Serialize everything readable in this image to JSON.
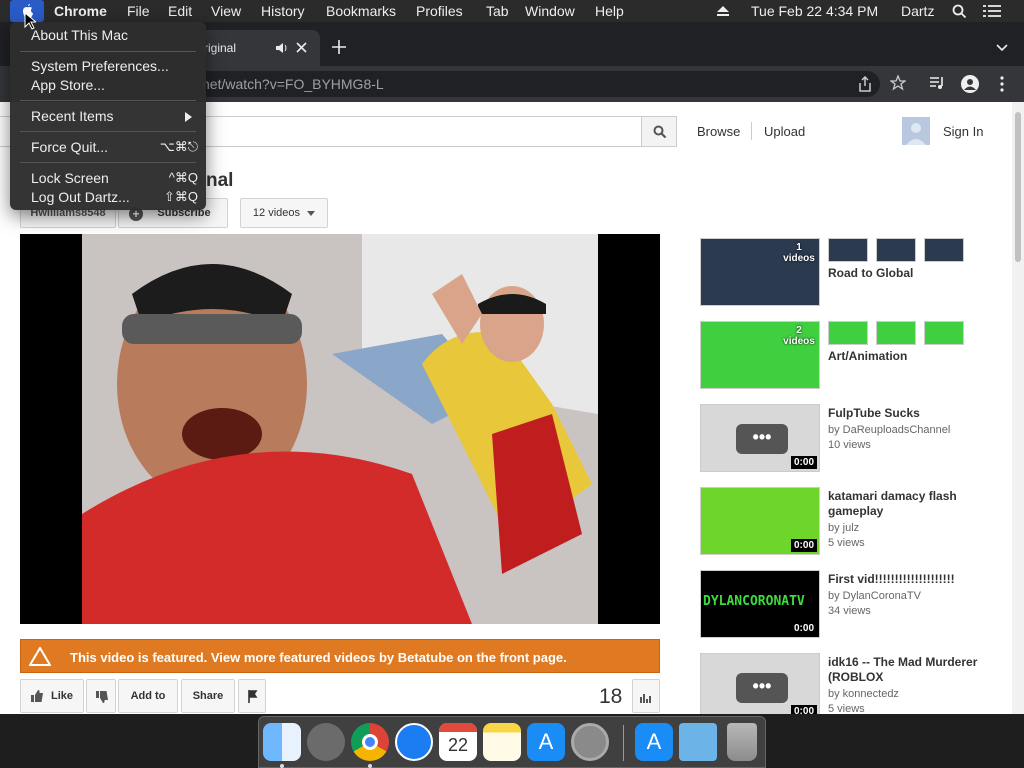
{
  "menubar": {
    "app": "Chrome",
    "items": [
      "File",
      "Edit",
      "View",
      "History",
      "Bookmarks",
      "Profiles",
      "Tab",
      "Window",
      "Help"
    ],
    "clock": "Tue Feb 22  4:34 PM",
    "user": "Dartz"
  },
  "apple_menu": {
    "about": "About This Mac",
    "prefs": "System Preferences...",
    "appstore": "App Store...",
    "recent": "Recent Items",
    "force_quit": "Force Quit...",
    "force_quit_sc": "⌥⌘⎋",
    "lock": "Lock Screen",
    "lock_sc": "^⌘Q",
    "logout": "Log Out Dartz...",
    "logout_sc": "⇧⌘Q"
  },
  "tab": {
    "title": "riginal"
  },
  "url": "net/watch?v=FO_BYHMG8-L",
  "site": {
    "nav_browse": "Browse",
    "nav_upload": "Upload",
    "sign_in": "Sign In",
    "video_title_partial": "nal",
    "channel": "Hwilliams8548",
    "subscribe": "Subscribe",
    "videos_count": "12 videos",
    "featured": "This video is featured. View more featured videos by Betatube on the front page.",
    "like": "Like",
    "add_to": "Add to",
    "share": "Share",
    "view_count": "18"
  },
  "sidebar": [
    {
      "title": "Road to Global",
      "count": "1",
      "count_label": "videos",
      "type": "playlist",
      "color": "#2b3a4f"
    },
    {
      "title": "Art/Animation",
      "count": "2",
      "count_label": "videos",
      "type": "playlist",
      "color": "#3fcf3f"
    },
    {
      "title": "FulpTube Sucks",
      "by": "by DaReuploadsChannel",
      "views": "10 views",
      "duration": "0:00",
      "color": "#d8d8d8"
    },
    {
      "title": "katamari damacy flash gameplay",
      "by": "by julz",
      "views": "5 views",
      "duration": "0:00",
      "color": "#6ed62a"
    },
    {
      "title": "First vid!!!!!!!!!!!!!!!!!!!!",
      "by": "by DylanCoronaTV",
      "views": "34 views",
      "duration": "0:00",
      "thumb_text": "DYLANCORONATV",
      "color": "#000000"
    },
    {
      "title": "idk16 -- The Mad Murderer (ROBLOX",
      "by": "by konnectedz",
      "views": "5 views",
      "duration": "0:00",
      "color": "#d8d8d8"
    }
  ],
  "colors": {
    "featured_bar": "#e07a22",
    "accent": "#2a5cc8"
  }
}
